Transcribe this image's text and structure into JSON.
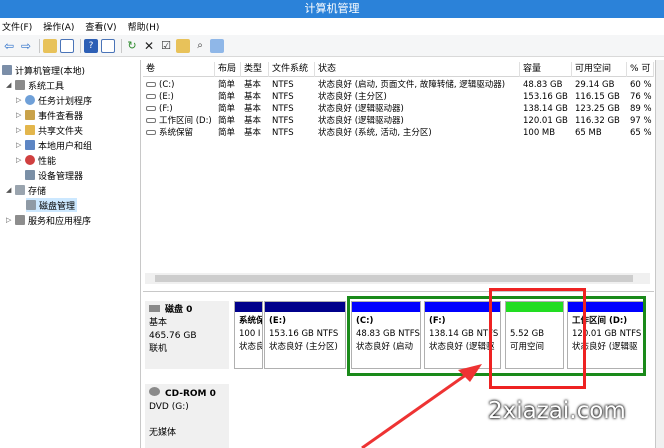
{
  "window": {
    "title": "计算机管理"
  },
  "menu": [
    "文件(F)",
    "操作(A)",
    "查看(V)",
    "帮助(H)"
  ],
  "toolbar_icons": [
    "back-icon",
    "forward-icon",
    "up-folder-icon",
    "show-hide-tree-icon",
    "help-icon",
    "properties-icon",
    "refresh-icon",
    "delete-icon",
    "check-icon",
    "folder-open-icon",
    "search-icon",
    "zoom-icon"
  ],
  "tree": {
    "root": "计算机管理(本地)",
    "items": [
      {
        "label": "系统工具"
      },
      {
        "label": "任务计划程序"
      },
      {
        "label": "事件查看器"
      },
      {
        "label": "共享文件夹"
      },
      {
        "label": "本地用户和组"
      },
      {
        "label": "性能"
      },
      {
        "label": "设备管理器"
      },
      {
        "label": "存储"
      },
      {
        "label": "磁盘管理"
      },
      {
        "label": "服务和应用程序"
      }
    ]
  },
  "volume_table": {
    "columns": [
      "卷",
      "布局",
      "类型",
      "文件系统",
      "状态",
      "容量",
      "可用空间",
      "% 可"
    ],
    "rows": [
      [
        "(C:)",
        "简单",
        "基本",
        "NTFS",
        "状态良好 (启动, 页面文件, 故障转储, 逻辑驱动器)",
        "48.83 GB",
        "29.14 GB",
        "60 %"
      ],
      [
        "(E:)",
        "简单",
        "基本",
        "NTFS",
        "状态良好 (主分区)",
        "153.16 GB",
        "116.15 GB",
        "76 %"
      ],
      [
        "(F:)",
        "简单",
        "基本",
        "NTFS",
        "状态良好 (逻辑驱动器)",
        "138.14 GB",
        "123.25 GB",
        "89 %"
      ],
      [
        "工作区间 (D:)",
        "简单",
        "基本",
        "NTFS",
        "状态良好 (逻辑驱动器)",
        "120.01 GB",
        "116.32 GB",
        "97 %"
      ],
      [
        "系统保留",
        "简单",
        "基本",
        "NTFS",
        "状态良好 (系统, 活动, 主分区)",
        "100 MB",
        "65 MB",
        "65 %"
      ]
    ]
  },
  "disk0": {
    "name": "磁盘 0",
    "type": "基本",
    "size": "465.76 GB",
    "status": "联机",
    "partitions": [
      {
        "name": "系统保",
        "size": "100 I",
        "status": "状态良"
      },
      {
        "name": "(E:)",
        "size": "153.16 GB NTFS",
        "status": "状态良好 (主分区)"
      },
      {
        "name": "(C:)",
        "size": "48.83 GB NTFS",
        "status": "状态良好 (启动"
      },
      {
        "name": "(F:)",
        "size": "138.14 GB NTFS",
        "status": "状态良好 (逻辑驱"
      },
      {
        "name": "",
        "size": "5.52 GB",
        "status": "可用空间"
      },
      {
        "name": "工作区间 (D:)",
        "size": "120.01 GB NTFS",
        "status": "状态良好 (逻辑驱"
      }
    ]
  },
  "cdrom0": {
    "name": "CD-ROM 0",
    "type": "DVD (G:)",
    "status": "无媒体"
  },
  "watermark": "2xiazai.com",
  "colors": {
    "titlebar": "#2b82d9",
    "primary_partition": "#00008b",
    "logical_partition": "#0000ff",
    "free_space": "#22dd22",
    "extended_border": "#1a8a1a",
    "highlight": "#ee2222"
  }
}
